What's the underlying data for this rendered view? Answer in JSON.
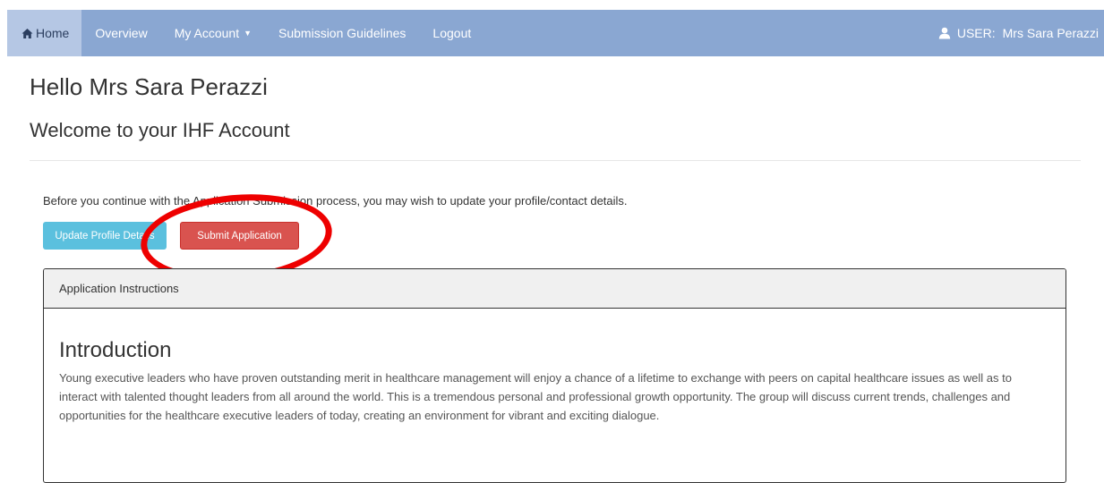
{
  "navbar": {
    "home_label": "Home",
    "items": [
      "Overview",
      "My Account",
      "Submission Guidelines",
      "Logout"
    ],
    "user_prefix": "USER:",
    "user_name": "Mrs Sara Perazzi"
  },
  "page": {
    "greeting": "Hello Mrs Sara Perazzi",
    "welcome": "Welcome to your IHF Account",
    "notice": "Before you continue with the Application Submission process, you may wish to update your profile/contact details."
  },
  "buttons": {
    "update_profile": "Update Profile Details",
    "submit_application": "Submit Application"
  },
  "panel": {
    "heading": "Application Instructions",
    "section_title": "Introduction",
    "section_text": "Young executive leaders who have proven outstanding merit in healthcare management will enjoy a chance of a lifetime to exchange with peers on capital healthcare issues as well as to interact with talented thought leaders from all around the world. This is a tremendous personal and professional growth opportunity. The group will discuss current trends, challenges and opportunities for the healthcare executive leaders of today, creating an environment for vibrant and exciting dialogue."
  },
  "colors": {
    "navbar_bg": "#8aa7d2",
    "active_tab_bg": "#b5c7e4",
    "update_button": "#5bc0de",
    "submit_button": "#d9534f",
    "annotation_circle": "#ee0000"
  },
  "icons": {
    "home": "home-icon",
    "user": "user-icon",
    "dropdown": "caret-down-icon"
  }
}
